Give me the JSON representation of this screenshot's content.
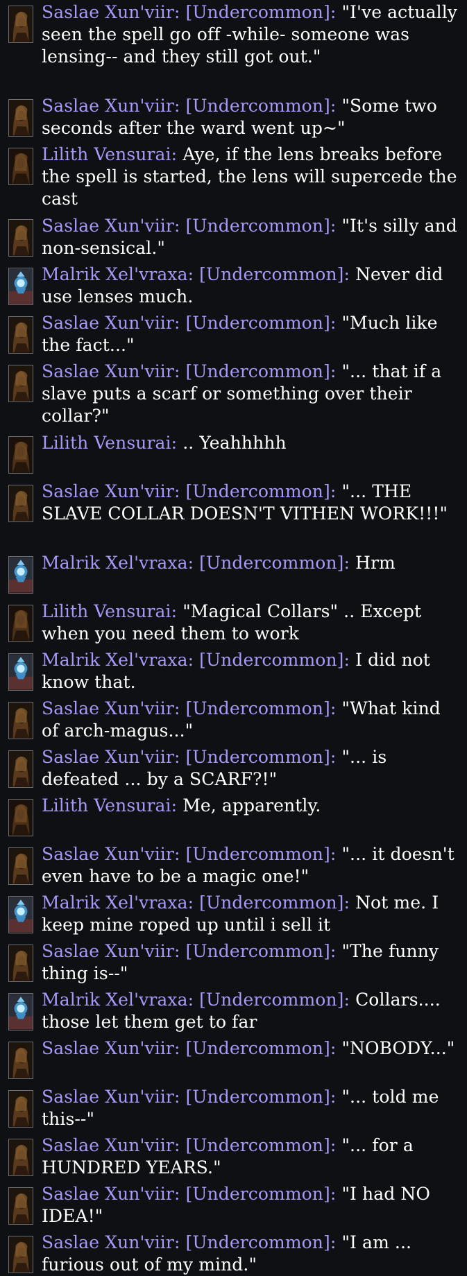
{
  "messages": [
    {
      "speaker": "Saslae Xun'viir:",
      "channel": "[Undercommon]:",
      "text": "\"I've actually seen the spell go off -while- someone was lensing-- and they still got out.\"",
      "avatar": "saslae-portrait-icon"
    },
    {
      "speaker": "Saslae Xun'viir:",
      "channel": "[Undercommon]:",
      "text": "\"Some two seconds after the ward went up~\"",
      "avatar": "saslae-portrait-icon"
    },
    {
      "speaker": "Lilith Vensurai:",
      "channel": "",
      "text": "Aye, if the lens breaks before the spell is started, the lens will supercede the cast",
      "avatar": "lilith-portrait-icon"
    },
    {
      "speaker": "Saslae Xun'viir:",
      "channel": "[Undercommon]:",
      "text": "\"It's silly and non-sensical.\"",
      "avatar": "saslae-portrait-icon"
    },
    {
      "speaker": "Malrik Xel'vraxa:",
      "channel": "[Undercommon]:",
      "text": "Never did use lenses much.",
      "avatar": "malrik-portrait-icon"
    },
    {
      "speaker": "Saslae Xun'viir:",
      "channel": "[Undercommon]:",
      "text": "\"Much like the fact...\"",
      "avatar": "saslae-portrait-icon"
    },
    {
      "speaker": "Saslae Xun'viir:",
      "channel": "[Undercommon]:",
      "text": "\"... that if a slave puts a scarf or something over their collar?\"",
      "avatar": "saslae-portrait-icon"
    },
    {
      "speaker": "Lilith Vensurai:",
      "channel": "",
      "text": ".. Yeahhhhh",
      "avatar": "lilith-portrait-icon"
    },
    {
      "speaker": "Saslae Xun'viir:",
      "channel": "[Undercommon]:",
      "text": "\"... THE SLAVE COLLAR DOESN'T VITHEN WORK!!!\"",
      "avatar": "saslae-portrait-icon"
    },
    {
      "speaker": "Malrik Xel'vraxa:",
      "channel": "[Undercommon]:",
      "text": "Hrm",
      "avatar": "malrik-portrait-icon"
    },
    {
      "speaker": "Lilith Vensurai:",
      "channel": "",
      "text": "\"Magical Collars\" .. Except when you need them to work",
      "avatar": "lilith-portrait-icon"
    },
    {
      "speaker": "Malrik Xel'vraxa:",
      "channel": "[Undercommon]:",
      "text": "I did not know that.",
      "avatar": "malrik-portrait-icon"
    },
    {
      "speaker": "Saslae Xun'viir:",
      "channel": "[Undercommon]:",
      "text": "\"What kind of arch-magus...\"",
      "avatar": "saslae-portrait-icon"
    },
    {
      "speaker": "Saslae Xun'viir:",
      "channel": "[Undercommon]:",
      "text": "\"... is defeated ... by a SCARF?!\"",
      "avatar": "saslae-portrait-icon"
    },
    {
      "speaker": "Lilith Vensurai:",
      "channel": "",
      "text": "Me, apparently.",
      "avatar": "lilith-portrait-icon"
    },
    {
      "speaker": "Saslae Xun'viir:",
      "channel": "[Undercommon]:",
      "text": "\"... it doesn't even have to be a magic one!\"",
      "avatar": "saslae-portrait-icon"
    },
    {
      "speaker": "Malrik Xel'vraxa:",
      "channel": "[Undercommon]:",
      "text": "Not me. I keep mine roped up until i sell it",
      "avatar": "malrik-portrait-icon"
    },
    {
      "speaker": "Saslae Xun'viir:",
      "channel": "[Undercommon]:",
      "text": "\"The funny thing is--\"",
      "avatar": "saslae-portrait-icon"
    },
    {
      "speaker": "Malrik Xel'vraxa:",
      "channel": "[Undercommon]:",
      "text": "Collars.... those let them get to far",
      "avatar": "malrik-portrait-icon"
    },
    {
      "speaker": "Saslae Xun'viir:",
      "channel": "[Undercommon]:",
      "text": "\"NOBODY...\"",
      "avatar": "saslae-portrait-icon"
    },
    {
      "speaker": "Saslae Xun'viir:",
      "channel": "[Undercommon]:",
      "text": "\"... told me this--\"",
      "avatar": "saslae-portrait-icon"
    },
    {
      "speaker": "Saslae Xun'viir:",
      "channel": "[Undercommon]:",
      "text": "\"... for a HUNDRED YEARS.\"",
      "avatar": "saslae-portrait-icon"
    },
    {
      "speaker": "Saslae Xun'viir:",
      "channel": "[Undercommon]:",
      "text": "\"I had NO IDEA!\"",
      "avatar": "saslae-portrait-icon"
    },
    {
      "speaker": "Saslae Xun'viir:",
      "channel": "[Undercommon]:",
      "text": "\"I am ... furious out of my mind.\"",
      "avatar": "saslae-portrait-icon"
    }
  ],
  "colors": {
    "background": "#0e1013",
    "speaker": "#a59af8",
    "text": "#ffffff"
  }
}
